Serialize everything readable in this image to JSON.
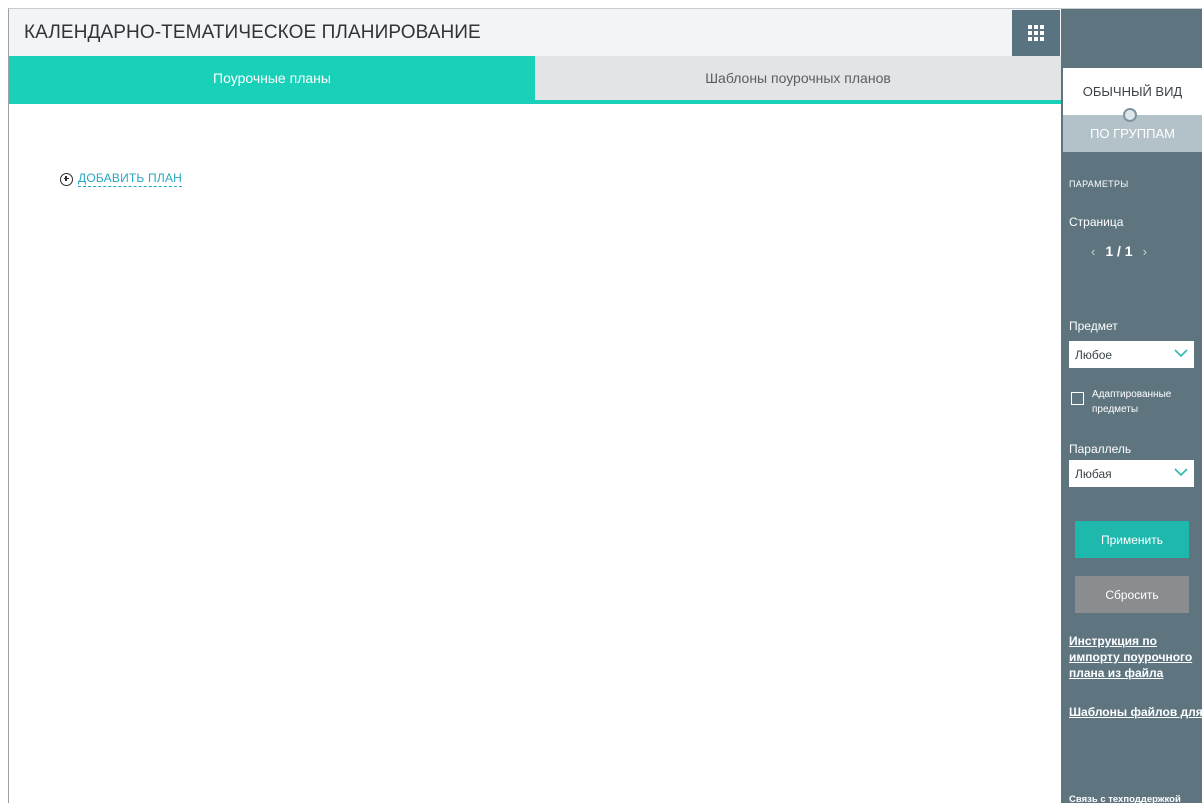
{
  "header": {
    "title": "КАЛЕНДАРНО-ТЕМАТИЧЕСКОЕ ПЛАНИРОВАНИЕ",
    "apps_icon": "grid-menu-icon"
  },
  "tabs": [
    {
      "label": "Поурочные планы",
      "active": true
    },
    {
      "label": "Шаблоны поурочных планов",
      "active": false
    }
  ],
  "main": {
    "add_plan_label": "ДОБАВИТЬ ПЛАН",
    "add_plan_icon": "plus-circle-icon"
  },
  "sidebar": {
    "view_normal": "ОБЫЧНЫЙ ВИД",
    "view_groups": "ПО ГРУППАМ",
    "params_heading": "ПАРАМЕТРЫ",
    "page_label": "Страница",
    "pager": {
      "value": "1 / 1",
      "prev": "‹",
      "next": "›"
    },
    "subject_label": "Предмет",
    "subject_value": "Любое",
    "adapted_label": "Адаптированные предметы",
    "parallel_label": "Параллель",
    "parallel_value": "Любая",
    "apply_label": "Применить",
    "reset_label": "Сбросить",
    "link_instruction": "Инструкция по импорту поурочного плана из файла",
    "link_templates": "Шаблоны файлов для импорта",
    "support": "Связь с техподдержкой"
  },
  "colors": {
    "accent_teal": "#19d1b8",
    "sidebar_bg": "#5e7580",
    "apply_button": "#1fb8ad",
    "reset_button": "#8a8d8f",
    "link_blue": "#2aa7c0"
  }
}
